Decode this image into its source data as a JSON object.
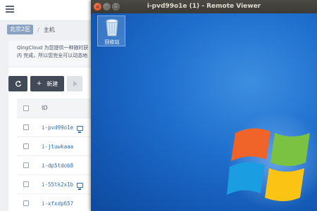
{
  "console": {
    "breadcrumb": {
      "zone": "北京2区",
      "separator": "/",
      "page": "主机"
    },
    "intro_lines": [
      "QingCloud 为您提供一种随时获",
      "内 完成，所以您完全可以动态地"
    ],
    "toolbar": {
      "new_label": "新建"
    },
    "table": {
      "header_id": "ID",
      "rows": [
        {
          "id": "i-pvd99o1e",
          "remote_icon": true
        },
        {
          "id": "i-jtuwkaaa",
          "remote_icon": false
        },
        {
          "id": "i-dp5tdob8",
          "remote_icon": false
        },
        {
          "id": "i-55tk2x1b",
          "remote_icon": true
        },
        {
          "id": "i-xfxdp657",
          "remote_icon": false
        }
      ]
    }
  },
  "viewer": {
    "title": "i-pvd99o1e (1) - Remote Viewer",
    "desktop_icon_label": "回收站"
  },
  "colors": {
    "breadcrumb_zone_bg": "#8aa3c3",
    "primary_button": "#414a56",
    "link_blue": "#2f6fb0",
    "desktop_blue": "#1f6fce",
    "close_button": "#e2572e"
  },
  "icons": [
    "menu-icon",
    "refresh-icon",
    "plus-icon",
    "play-icon",
    "monitor-icon",
    "recycle-bin-icon",
    "windows-logo-icon"
  ]
}
